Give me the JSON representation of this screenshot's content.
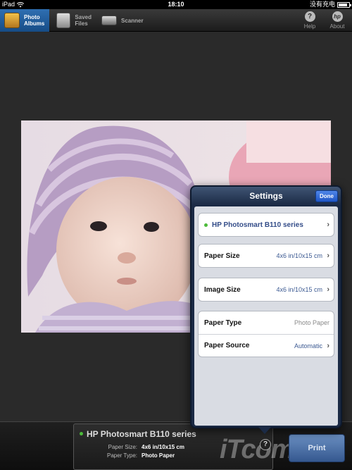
{
  "status_bar": {
    "device": "iPad",
    "time": "18:10",
    "charge_text": "没有充电"
  },
  "toolbar": {
    "tabs": [
      {
        "label_line1": "Photo",
        "label_line2": "Albums",
        "icon": "photo-album-icon",
        "active": true
      },
      {
        "label_line1": "Saved",
        "label_line2": "Files",
        "icon": "folder-icon",
        "active": false
      },
      {
        "label_line1": "Scanner",
        "label_line2": "",
        "icon": "scanner-icon",
        "active": false
      }
    ],
    "help": {
      "label": "Help",
      "glyph": "?"
    },
    "about": {
      "label": "About",
      "glyph": "hp"
    }
  },
  "settings": {
    "title": "Settings",
    "done_label": "Done",
    "printer_name": "HP Photosmart B110 series",
    "rows": {
      "paper_size": {
        "label": "Paper Size",
        "value": "4x6 in/10x15 cm"
      },
      "image_size": {
        "label": "Image Size",
        "value": "4x6 in/10x15 cm"
      },
      "paper_type": {
        "label": "Paper Type",
        "value": "Photo Paper"
      },
      "paper_source": {
        "label": "Paper Source",
        "value": "Automatic"
      }
    }
  },
  "bottom": {
    "printer_name": "HP Photosmart B110 series",
    "paper_size_label": "Paper Size:",
    "paper_size_value": "4x6 in/10x15 cm",
    "paper_type_label": "Paper Type:",
    "paper_type_value": "Photo Paper",
    "print_label": "Print",
    "help_glyph": "?"
  },
  "watermark": "iTcom.cn",
  "colors": {
    "toolbar_active": "#2f6fb2",
    "popover_bg": "#1b2a45",
    "done_button": "#3b74e0",
    "status_dot": "#4cbb3a",
    "print_button": "#4a6fa5"
  }
}
